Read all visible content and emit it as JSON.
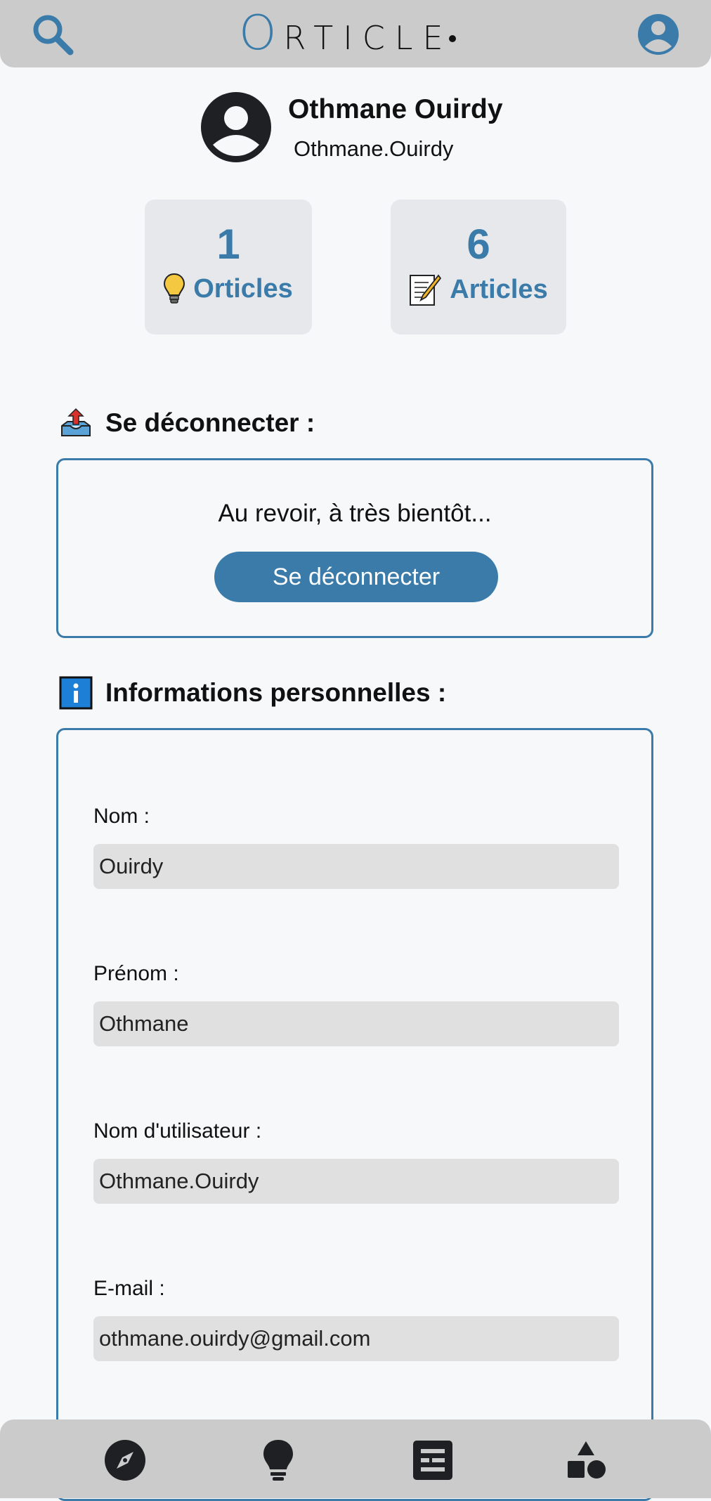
{
  "header": {
    "logo_first": "O",
    "logo_rest": "RTICLE",
    "search_icon": "search-icon",
    "account_icon": "account-circle-icon"
  },
  "profile": {
    "name": "Othmane Ouirdy",
    "username": "Othmane.Ouirdy",
    "avatar_icon": "user-avatar-icon"
  },
  "stats": [
    {
      "count": "1",
      "label": "Orticles",
      "icon": "light-bulb-icon"
    },
    {
      "count": "6",
      "label": "Articles",
      "icon": "memo-icon"
    }
  ],
  "logout_section": {
    "title": "Se déconnecter :",
    "message": "Au revoir, à très bientôt...",
    "button_label": "Se déconnecter",
    "icon": "outbox-tray-icon"
  },
  "info_section": {
    "title": "Informations personnelles :",
    "icon": "information-icon",
    "fields": [
      {
        "label": "Nom :",
        "value": "Ouirdy"
      },
      {
        "label": "Prénom :",
        "value": "Othmane"
      },
      {
        "label": "Nom d'utilisateur :",
        "value": "Othmane.Ouirdy"
      },
      {
        "label": "E-mail :",
        "value": "othmane.ouirdy@gmail.com"
      }
    ]
  },
  "bottom_nav": [
    {
      "icon": "compass-icon"
    },
    {
      "icon": "light-bulb-icon"
    },
    {
      "icon": "article-icon"
    },
    {
      "icon": "shapes-icon"
    }
  ],
  "colors": {
    "accent": "#3a7baa",
    "bar_bg": "#cbcbcb",
    "page_bg": "#f6f8fa",
    "card_bg": "#e6e8eb",
    "input_bg": "#e0e0e0"
  }
}
